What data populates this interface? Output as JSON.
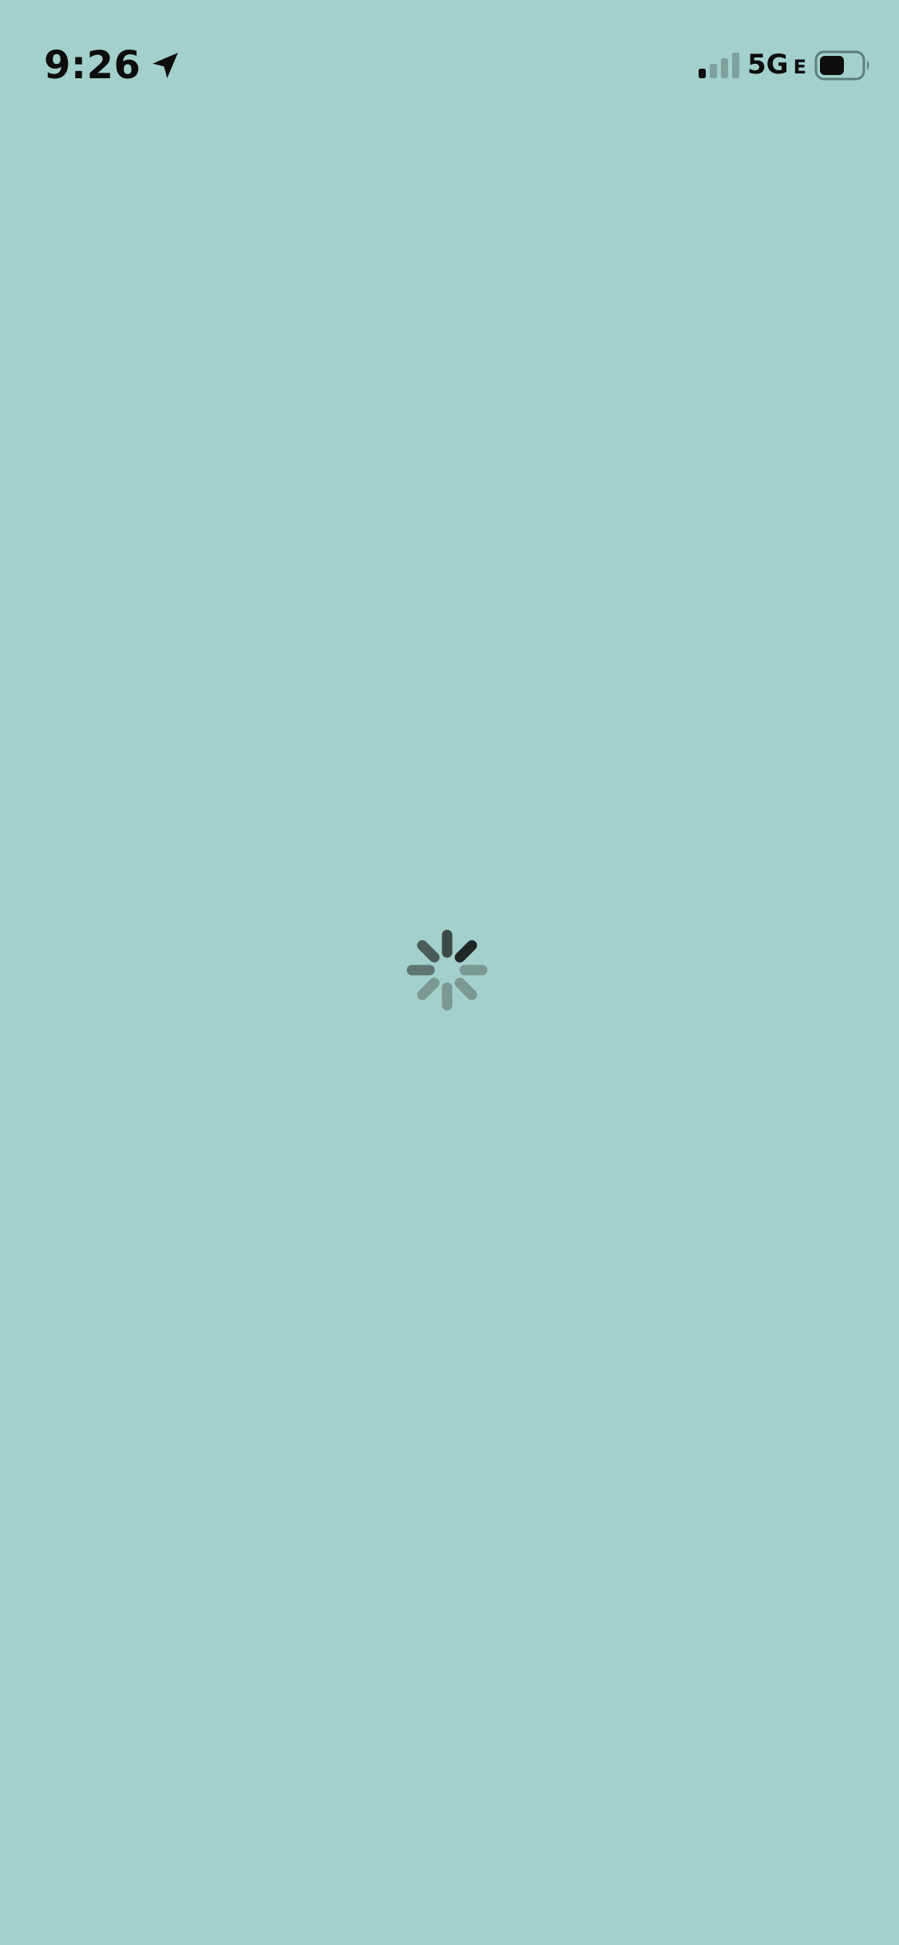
{
  "status_bar": {
    "time": "9:26",
    "network": "5G",
    "network_suffix": "E",
    "location_icon": "location-arrow-icon",
    "signal_icon": "cellular-signal-icon",
    "signal_strength_bars": 1,
    "signal_total_bars": 4,
    "battery_icon": "battery-icon",
    "battery_level": 0.6
  },
  "main": {
    "background_color": "#a3d0ca",
    "loading_indicator": "loading-spinner-icon"
  }
}
